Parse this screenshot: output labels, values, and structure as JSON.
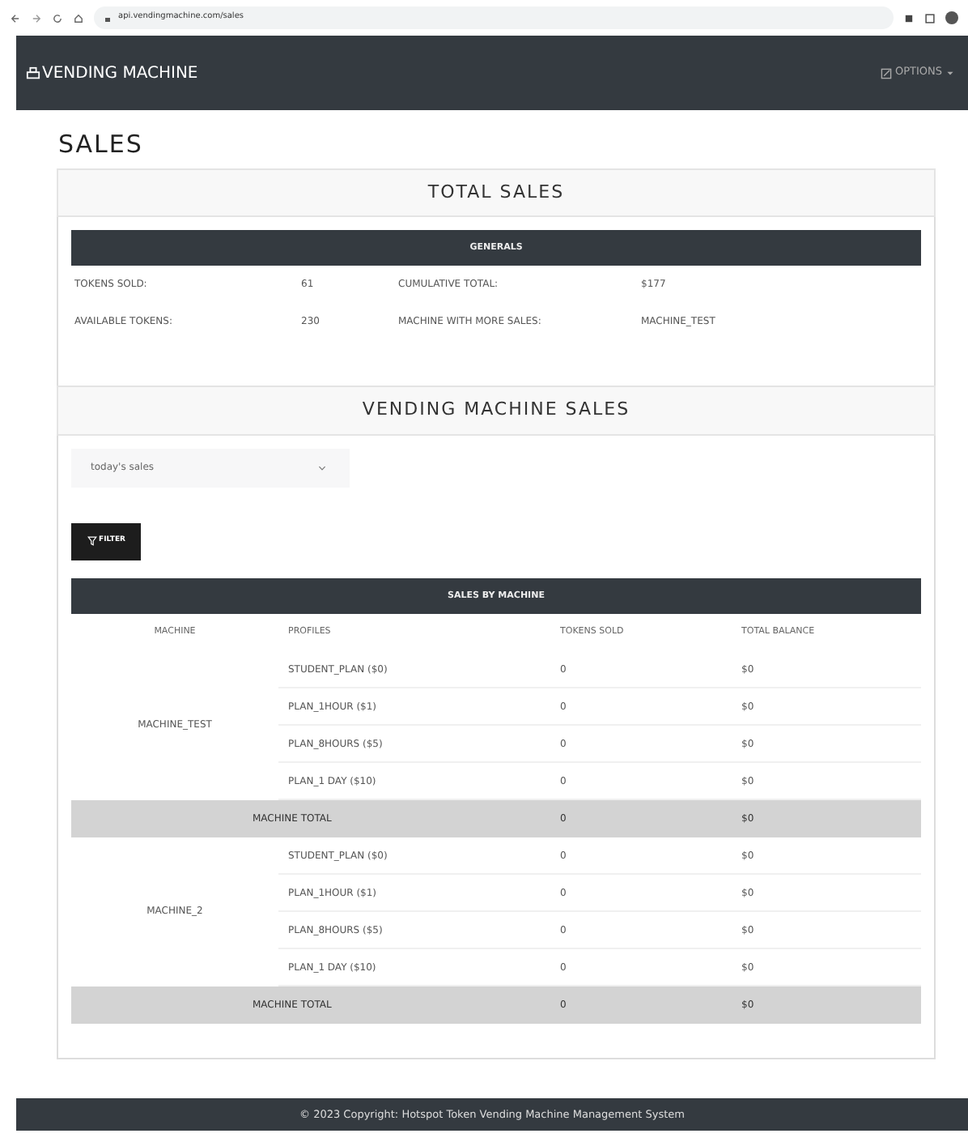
{
  "browser": {
    "url": "api.vendingmachine.com/sales"
  },
  "navbar": {
    "brand": "VENDING MACHINE",
    "menu": "OPTIONS"
  },
  "page_title": "SALES",
  "total_sales": {
    "title": "TOTAL SALES",
    "table_title": "GENERALS",
    "stats": [
      {
        "label": "TOKENS SOLD:",
        "value": "61",
        "label2": "CUMULATIVE TOTAL:",
        "value2": "$177"
      },
      {
        "label": "AVAILABLE TOKENS:",
        "value": "230",
        "label2": "MACHINE WITH MORE SALES:",
        "value2": "MACHINE_TEST"
      }
    ]
  },
  "machine_sales": {
    "title": "VENDING MACHINE SALES",
    "period": "today's sales",
    "filter_button": "FILTER",
    "table_title": "SALES BY MACHINE",
    "columns": [
      "MACHINE",
      "PROFILES",
      "TOKENS SOLD",
      "TOTAL BALANCE"
    ],
    "machines": [
      {
        "name": "MACHINE_TEST",
        "profiles": [
          {
            "profile": "STUDENT_PLAN ($0)",
            "tokens": "0",
            "balance": "$0"
          },
          {
            "profile": "PLAN_1HOUR ($1)",
            "tokens": "0",
            "balance": "$0"
          },
          {
            "profile": "PLAN_8HOURS ($5)",
            "tokens": "0",
            "balance": "$0"
          },
          {
            "profile": "PLAN_1 DAY ($10)",
            "tokens": "0",
            "balance": "$0"
          }
        ],
        "total_label": "MACHINE TOTAL",
        "total_tokens": "0",
        "total_balance": "$0"
      },
      {
        "name": "MACHINE_2",
        "profiles": [
          {
            "profile": "STUDENT_PLAN ($0)",
            "tokens": "0",
            "balance": "$0"
          },
          {
            "profile": "PLAN_1HOUR ($1)",
            "tokens": "0",
            "balance": "$0"
          },
          {
            "profile": "PLAN_8HOURS ($5)",
            "tokens": "0",
            "balance": "$0"
          },
          {
            "profile": "PLAN_1 DAY ($10)",
            "tokens": "0",
            "balance": "$0"
          }
        ],
        "total_label": "MACHINE TOTAL",
        "total_tokens": "0",
        "total_balance": "$0"
      }
    ]
  },
  "footer": "© 2023 Copyright: Hotspot Token Vending Machine Management System"
}
